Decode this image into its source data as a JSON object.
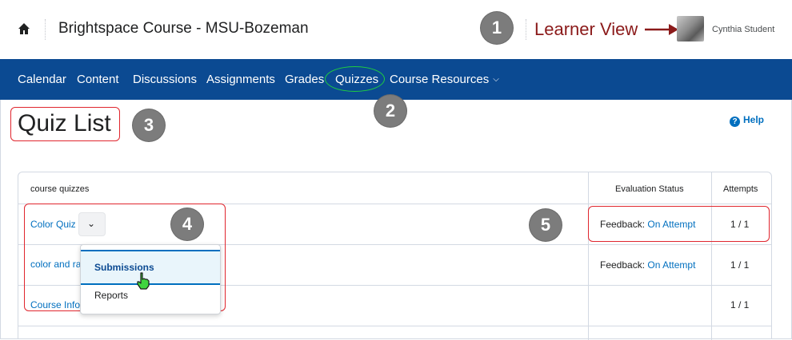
{
  "header": {
    "course_title": "Brightspace Course - MSU-Bozeman",
    "learner_view_label": "Learner View",
    "user_name": "Cynthia Student"
  },
  "nav": {
    "items": [
      "Calendar",
      "Content",
      "Discussions",
      "Assignments",
      "Grades",
      "Quizzes",
      "Course Resources"
    ]
  },
  "page": {
    "title": "Quiz List",
    "help_label": "Help"
  },
  "callouts": [
    "1",
    "2",
    "3",
    "4",
    "5"
  ],
  "table": {
    "headers": [
      "course quizzes",
      "Evaluation Status",
      "Attempts"
    ],
    "rows": [
      {
        "quiz": "Color Quiz",
        "status_label": "Feedback:",
        "status_link": "On Attempt",
        "attempts": "1 / 1"
      },
      {
        "quiz": "color and ra",
        "status_label": "Feedback:",
        "status_link": "On Attempt",
        "attempts": "1 / 1"
      },
      {
        "quiz": "Course Info",
        "status_label": "",
        "status_link": "",
        "attempts": "1 / 1"
      }
    ]
  },
  "dropdown": {
    "items": [
      "Submissions",
      "Reports"
    ]
  },
  "colors": {
    "nav_bg": "#0b4a92",
    "link": "#006fbf",
    "annotation_red": "#e0262e",
    "learner_view_red": "#8b1a1a",
    "quiz_highlight_green": "#1fcf3f",
    "callout_gray": "#7c7c7c"
  },
  "icons": [
    "home-icon",
    "arrow-right-icon",
    "chevron-down-icon",
    "help-icon",
    "hand-cursor-icon"
  ]
}
